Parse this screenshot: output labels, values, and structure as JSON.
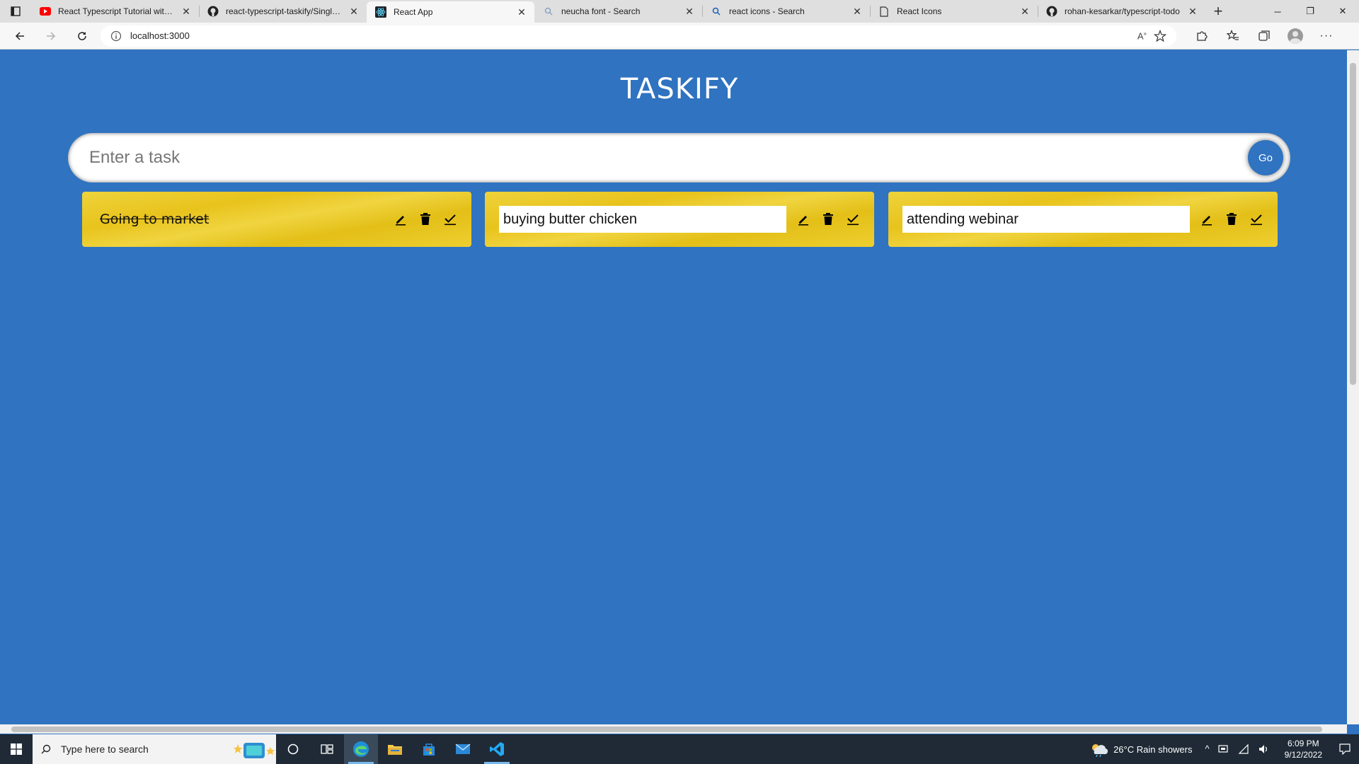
{
  "browser": {
    "tabs": [
      {
        "title": "React Typescript Tutorial with Pr",
        "icon": "youtube-icon"
      },
      {
        "title": "react-typescript-taskify/SingleTo",
        "icon": "github-icon"
      },
      {
        "title": "React App",
        "icon": "react-icon",
        "active": true
      },
      {
        "title": "neucha font - Search",
        "icon": "search-icon"
      },
      {
        "title": "react icons - Search",
        "icon": "search-icon"
      },
      {
        "title": "React Icons",
        "icon": "page-icon"
      },
      {
        "title": "rohan-kesarkar/typescript-todo",
        "icon": "github-icon"
      }
    ],
    "url": "localhost:3000"
  },
  "app": {
    "title": "TASKIFY",
    "input_placeholder": "Enter a task",
    "go_label": "Go",
    "todos": [
      {
        "text": "Going to market",
        "done": true
      },
      {
        "text": "buying butter chicken",
        "editing": true
      },
      {
        "text": "attending webinar",
        "editing": true
      }
    ]
  },
  "taskbar": {
    "search_placeholder": "Type here to search",
    "weather": "26°C  Rain showers",
    "time": "6:09 PM",
    "date": "9/12/2022"
  },
  "colors": {
    "page_bg": "#2f73c1",
    "card_bg": "#e8c31c",
    "go_button": "#2f73c1"
  }
}
